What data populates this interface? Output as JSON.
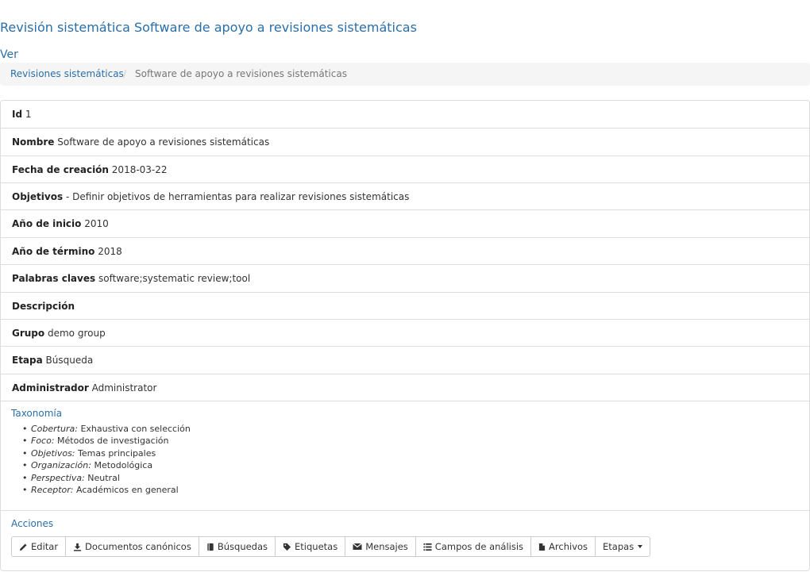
{
  "page": {
    "title": "Revisión sistemática Software de apoyo a revisiones sistemáticas",
    "subtitle": "Ver"
  },
  "breadcrumb": {
    "link": "Revisiones sistemáticas",
    "separator": "/",
    "current": "Software de apoyo a revisiones sistemáticas"
  },
  "details": [
    {
      "label": "Id",
      "value": "1"
    },
    {
      "label": "Nombre",
      "value": "Software de apoyo a revisiones sistemáticas"
    },
    {
      "label": "Fecha de creación",
      "value": "2018-03-22"
    },
    {
      "label": "Objetivos",
      "value": "- Definir objetivos de herramientas para realizar revisiones sistemáticas"
    },
    {
      "label": "Año de inicio",
      "value": "2010"
    },
    {
      "label": "Año de término",
      "value": "2018"
    },
    {
      "label": "Palabras claves",
      "value": "software;systematic review;tool"
    },
    {
      "label": "Descripción",
      "value": ""
    },
    {
      "label": "Grupo",
      "value": "demo group"
    },
    {
      "label": "Etapa",
      "value": "Búsqueda"
    },
    {
      "label": "Administrador",
      "value": "Administrator"
    }
  ],
  "taxonomy": {
    "title": "Taxonomía",
    "items": [
      {
        "key": "Cobertura:",
        "value": "Exhaustiva con selección"
      },
      {
        "key": "Foco:",
        "value": "Métodos de investigación"
      },
      {
        "key": "Objetivos:",
        "value": "Temas principales"
      },
      {
        "key": "Organización:",
        "value": "Metodológica"
      },
      {
        "key": "Perspectiva:",
        "value": "Neutral"
      },
      {
        "key": "Receptor:",
        "value": "Académicos en general"
      }
    ]
  },
  "actions": {
    "title": "Acciones",
    "buttons": [
      {
        "label": "Editar",
        "icon": "pencil-icon"
      },
      {
        "label": "Documentos canónicos",
        "icon": "download-icon"
      },
      {
        "label": "Búsquedas",
        "icon": "book-icon"
      },
      {
        "label": "Etiquetas",
        "icon": "tag-icon"
      },
      {
        "label": "Mensajes",
        "icon": "envelope-icon"
      },
      {
        "label": "Campos de análisis",
        "icon": "list-icon"
      },
      {
        "label": "Archivos",
        "icon": "file-icon"
      },
      {
        "label": "Etapas",
        "icon": "caret-down-icon"
      }
    ]
  }
}
